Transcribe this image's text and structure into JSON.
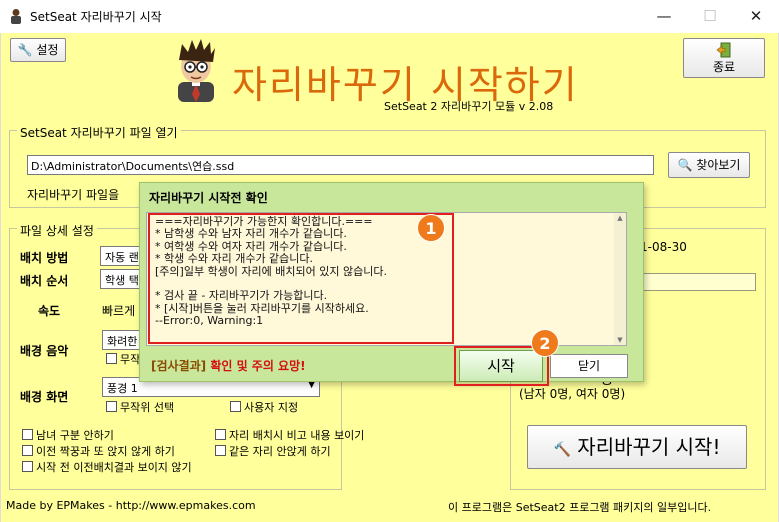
{
  "window": {
    "title": "SetSeat 자리바꾸기 시작",
    "min_glyph": "—",
    "max_glyph": "☐",
    "close_glyph": "✕"
  },
  "header": {
    "settings_label": "설정",
    "exit_label": "종료",
    "big_title": "자리바꾸기 시작하기",
    "subtitle": "SetSeat 2 자리바꾸기 모듈 v 2.08"
  },
  "file_group": {
    "label": "SetSeat 자리바꾸기 파일 열기",
    "path": "D:\\Administrator\\Documents\\연습.ssd",
    "browse_label": "찾아보기",
    "message_partial": "자리바꾸기 파일을"
  },
  "detail_group": {
    "label": "파일 상세 설정",
    "placement_method_label": "배치 방법",
    "placement_method_value": "자동 랜",
    "placement_order_label": "배치 순서",
    "placement_order_value": "학생 택",
    "speed_label": "속도",
    "speed_value": "빠르게",
    "music_label": "배경 음악",
    "music_value": "화려한",
    "music_random_label": "무작",
    "screen_label": "배경 화면",
    "screen_value": "풍경 1",
    "random_select_label": "무작위 선택",
    "user_specified_label": "사용자 지정",
    "options": [
      "남녀 구분 안하기",
      "자리 배치시 비고 내용 보이기",
      "이전 짝꿍과 또 앉지 않게 하기",
      "같은 자리 안앉게 하기",
      "시작 전 이전배치결과 보이지 않기"
    ]
  },
  "right_group": {
    "date_partial": "1-08-30",
    "student_count_head": "명",
    "student_count": "(남자 0명, 여자 0명)",
    "start_button_label": "자리바꾸기 시작!"
  },
  "dialog": {
    "title": "자리바꾸기 시작전 확인",
    "log": "===자리바꾸기가 가능한지 확인합니다.===\n* 남학생 수와 남자 자리 개수가 같습니다.\n* 여학생 수와 여자 자리 개수가 같습니다.\n* 학생 수와 자리 개수가 같습니다.\n[주의]일부 학생이 자리에 배치되어 있지 않습니다.\n\n* 검사 끝 - 자리바꾸기가 가능합니다.\n* [시작]버튼을 눌러 자리바꾸기를 시작하세요.\n--Error:0, Warning:1",
    "result_header": "[검사결과]",
    "result_text": "확인 및 주의 요망!",
    "confirm_label": "시작",
    "close_label": "닫기",
    "badge1": "1",
    "badge2": "2"
  },
  "footer": {
    "left": "Made by EPMakes - http://www.epmakes.com",
    "right": "이 프로그램은 SetSeat2 프로그램 패키지의 일부입니다."
  },
  "colors": {
    "client_bg": "#FFFF9C",
    "title_orange": "#D9690A",
    "dialog_bg": "#C9E79B",
    "highlight_red": "#E02020",
    "badge_orange": "#EF7A1B"
  }
}
